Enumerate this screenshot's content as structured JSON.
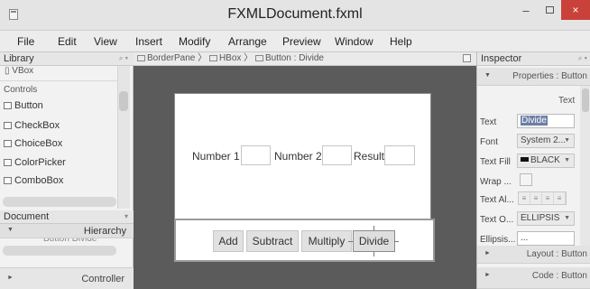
{
  "window": {
    "title": "FXMLDocument.fxml",
    "minimize": "–",
    "close": "×"
  },
  "menu": [
    "File",
    "Edit",
    "View",
    "Insert",
    "Modify",
    "Arrange",
    "Preview",
    "Window",
    "Help"
  ],
  "library": {
    "title": "Library",
    "partial_item": "VBox",
    "section": "Controls",
    "items": [
      "Button",
      "CheckBox",
      "ChoiceBox",
      "ColorPicker",
      "ComboBox"
    ]
  },
  "document": {
    "title": "Document",
    "hierarchy": "Hierarchy",
    "hidden_row": "Button  Divide",
    "controller": "Controller"
  },
  "breadcrumb": [
    "BorderPane",
    "HBox",
    "Button : Divide"
  ],
  "form": {
    "number1_label": "Number 1",
    "number2_label": "Number 2",
    "result_label": "Result",
    "buttons": [
      "Add",
      "Subtract",
      "Multiply",
      "Divide"
    ]
  },
  "inspector": {
    "title": "Inspector",
    "properties_header": "Properties : Button",
    "text_section": "Text",
    "props": {
      "text_label": "Text",
      "text_value": "Divide",
      "font_label": "Font",
      "font_value": "System 2...",
      "fill_label": "Text Fill",
      "fill_value": "BLACK",
      "wrap_label": "Wrap ...",
      "align_label": "Text Al...",
      "overrun_label": "Text O...",
      "overrun_value": "ELLIPSIS",
      "ellipsis_label": "Ellipsis...",
      "ellipsis_value": "..."
    },
    "layout_header": "Layout : Button",
    "code_header": "Code : Button"
  }
}
